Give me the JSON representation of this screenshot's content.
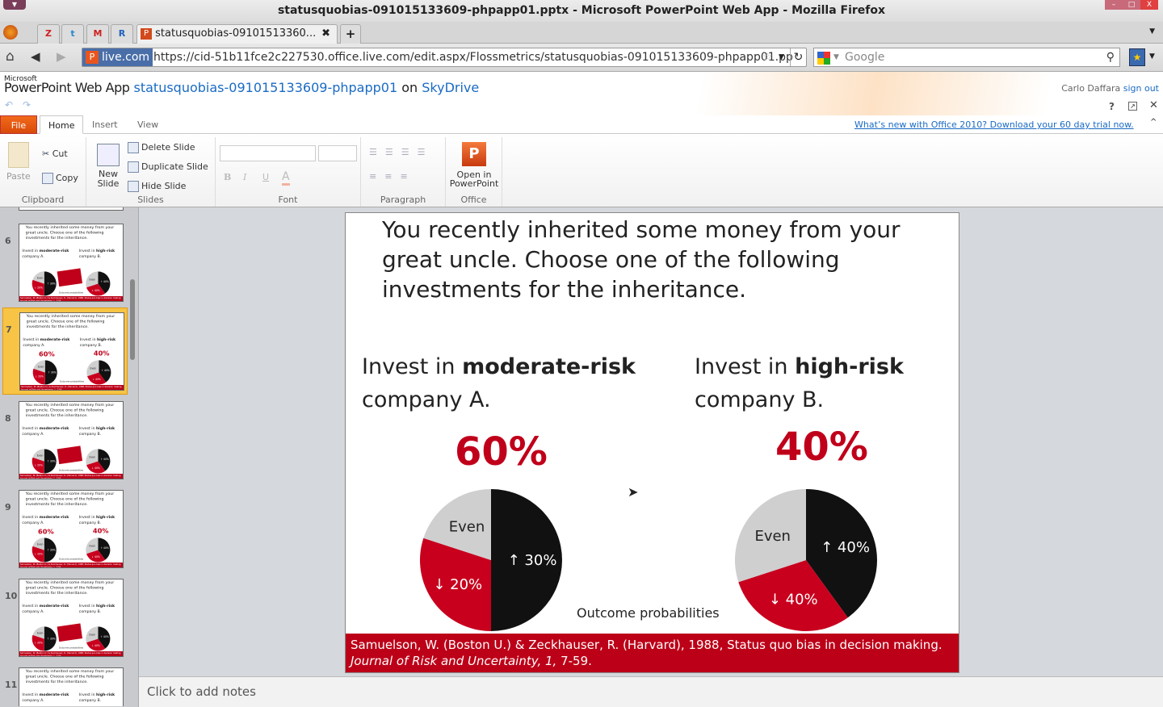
{
  "window": {
    "title": "statusquobias-091015133609-phpapp01.pptx - Microsoft PowerPoint Web App - Mozilla Firefox",
    "min": "–",
    "max": "□",
    "close": "X"
  },
  "browser": {
    "tabs": [
      {
        "label": "Z",
        "icon": "zotero-icon"
      },
      {
        "label": "t",
        "icon": "twitter-icon"
      },
      {
        "label": "M",
        "icon": "gmail-icon"
      },
      {
        "label": "R",
        "icon": "reader-icon"
      },
      {
        "label": "statusquobias-09101513360...",
        "icon": "powerpoint-icon",
        "active": true
      }
    ],
    "new_tab": "+",
    "close_tab": "✖",
    "site_identity": "live.com",
    "url": "https://cid-51b11fce2c227530.office.live.com/edit.aspx/Flossmetrics/statusquobias-091015133609-phpapp01.pp",
    "search_placeholder": "Google"
  },
  "app": {
    "brand_small": "Microsoft",
    "brand": "PowerPoint Web App",
    "doc_name": "statusquobias-091015133609-phpapp01",
    "on": "on",
    "location": "SkyDrive",
    "user": "Carlo Daffara",
    "sign_out": "sign out",
    "promo": "What’s new with Office 2010? Download your 60 day trial now."
  },
  "ribbon": {
    "tabs": [
      "File",
      "Home",
      "Insert",
      "View"
    ],
    "active_tab": "Home",
    "clipboard": {
      "label": "Clipboard",
      "paste": "Paste",
      "cut": "Cut",
      "copy": "Copy"
    },
    "slides": {
      "label": "Slides",
      "new": "New Slide",
      "delete": "Delete Slide",
      "duplicate": "Duplicate Slide",
      "hide": "Hide Slide"
    },
    "font": {
      "label": "Font",
      "bold": "B",
      "italic": "I",
      "underline": "U",
      "color": "A"
    },
    "paragraph": {
      "label": "Paragraph"
    },
    "office": {
      "label": "Office",
      "open": "Open in PowerPoint"
    }
  },
  "thumbnails": [
    {
      "num": "6",
      "selected": false
    },
    {
      "num": "7",
      "selected": true
    },
    {
      "num": "8",
      "selected": false
    },
    {
      "num": "9",
      "selected": false
    },
    {
      "num": "10",
      "selected": false
    },
    {
      "num": "11",
      "selected": false
    }
  ],
  "slide": {
    "title": "You recently inherited some money from your great uncle.  Choose one of the following investments for the inheritance.",
    "left": {
      "prefix": "Invest in ",
      "bold": "moderate-risk",
      "line2": "company A.",
      "pct": "60%"
    },
    "right": {
      "prefix": "Invest in ",
      "bold": "high-risk",
      "line2": "company B.",
      "pct": "40%"
    },
    "outcome": "Outcome probabilities",
    "cite": "Samuelson,  W. (Boston U.) & Zeckhauser, R. (Harvard), 1988, Status quo bias in decision  making. ",
    "cite_italic": "Journal of Risk and Uncertainty, 1,",
    "cite_end": " 7-59."
  },
  "chart_data": [
    {
      "type": "pie",
      "slices": [
        {
          "label": "↑ 30%",
          "value": 50,
          "color": "#111111"
        },
        {
          "label": "↓ 20%",
          "value": 30,
          "color": "#c8001e"
        },
        {
          "label": "Even",
          "value": 20,
          "color": "#cfcfcf"
        }
      ]
    },
    {
      "type": "pie",
      "slices": [
        {
          "label": "↑ 40%",
          "value": 40,
          "color": "#111111"
        },
        {
          "label": "↓ 40%",
          "value": 30,
          "color": "#c8001e"
        },
        {
          "label": "Even",
          "value": 30,
          "color": "#cfcfcf"
        }
      ]
    }
  ],
  "notes": {
    "placeholder": "Click to add notes"
  }
}
